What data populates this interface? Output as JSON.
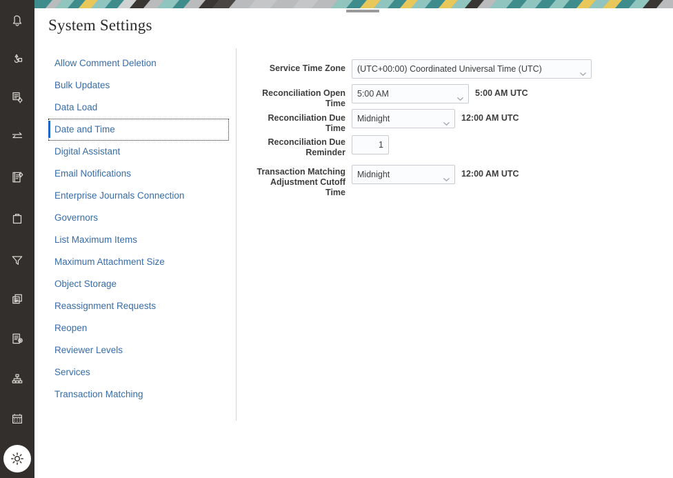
{
  "window": {
    "title": "System Settings",
    "drag_handle": "window-drag-handle"
  },
  "theme": {
    "rail_bg": "#332f2d",
    "link_blue": "#376ca8",
    "selected_bar": "#1a68c4",
    "label_gray": "#3d3d3d",
    "field_border": "#c8ccd0",
    "field_bg": "#fbfcfd",
    "divider": "#d6d6d6",
    "banner_teal": "#3f8c8c",
    "banner_light_teal": "#8fc4bf",
    "banner_yellow": "#e8c85a",
    "banner_gray": "#b9bbbc",
    "banner_dark": "#3a3634"
  },
  "rail": {
    "items": [
      {
        "icon": "bell-icon",
        "label": "Notifications"
      },
      {
        "icon": "reassignment-icon",
        "label": "Reassignments"
      },
      {
        "icon": "document-settings-icon",
        "label": "Rules"
      },
      {
        "icon": "transfer-arrows-icon",
        "label": "Transaction Matching"
      },
      {
        "icon": "list-settings-icon",
        "label": "Journals"
      },
      {
        "icon": "clipboard-icon",
        "label": "Tasks"
      },
      {
        "icon": "filter-funnel-icon",
        "label": "Filters"
      },
      {
        "icon": "copy-documents-icon",
        "label": "Reports"
      },
      {
        "icon": "document-view-icon",
        "label": "Views"
      },
      {
        "icon": "hierarchy-icon",
        "label": "Organizations"
      },
      {
        "icon": "calendar-icon",
        "label": "Calendar"
      }
    ],
    "fab": {
      "icon": "gear-icon",
      "label": "Tools"
    }
  },
  "settings_nav": {
    "items": [
      {
        "label": "Allow Comment Deletion",
        "selected": false
      },
      {
        "label": "Bulk Updates",
        "selected": false
      },
      {
        "label": "Data Load",
        "selected": false
      },
      {
        "label": "Date and Time",
        "selected": true
      },
      {
        "label": "Digital Assistant",
        "selected": false
      },
      {
        "label": "Email Notifications",
        "selected": false
      },
      {
        "label": "Enterprise Journals Connection",
        "selected": false
      },
      {
        "label": "Governors",
        "selected": false
      },
      {
        "label": "List Maximum Items",
        "selected": false
      },
      {
        "label": "Maximum Attachment Size",
        "selected": false
      },
      {
        "label": "Object Storage",
        "selected": false
      },
      {
        "label": "Reassignment Requests",
        "selected": false
      },
      {
        "label": "Reopen",
        "selected": false
      },
      {
        "label": "Reviewer Levels",
        "selected": false
      },
      {
        "label": "Services",
        "selected": false
      },
      {
        "label": "Transaction Matching",
        "selected": false
      }
    ]
  },
  "form": {
    "service_time_zone": {
      "label": "Service Time Zone",
      "value": "(UTC+00:00) Coordinated Universal Time (UTC)",
      "options": [
        "(UTC+00:00) Coordinated Universal Time (UTC)"
      ],
      "suffix": ""
    },
    "reconciliation_open_time": {
      "label": "Reconciliation Open Time",
      "value": "5:00 AM",
      "options": [
        "5:00 AM"
      ],
      "suffix": "5:00 AM UTC"
    },
    "reconciliation_due_time": {
      "label": "Reconciliation Due Time",
      "value": "Midnight",
      "options": [
        "Midnight"
      ],
      "suffix": "12:00 AM UTC"
    },
    "reconciliation_due_reminder": {
      "label_line1": "Reconciliation Due",
      "label_line2": "Reminder",
      "value": "1",
      "suffix": ""
    },
    "transaction_matching_cutoff": {
      "label_line1": "Transaction Matching",
      "label_line2": "Adjustment Cutoff Time",
      "value": "Midnight",
      "options": [
        "Midnight"
      ],
      "suffix": "12:00 AM UTC"
    }
  }
}
